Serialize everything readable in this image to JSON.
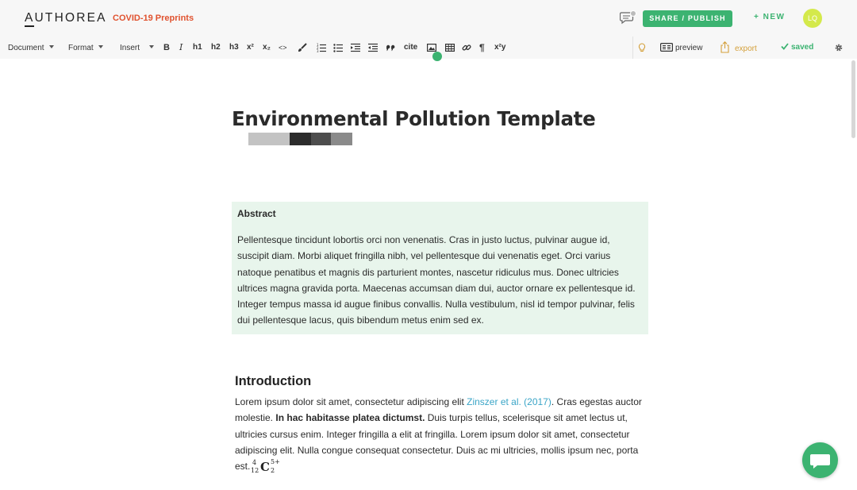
{
  "header": {
    "logo": "AUTHOREA",
    "covid_link": "COVID-19 Preprints",
    "share_label": "SHARE / PUBLISH",
    "new_label": "+ NEW",
    "avatar_initials": "LQ"
  },
  "toolbar": {
    "menus": [
      "Document",
      "Format",
      "Insert"
    ],
    "buttons": {
      "bold": "B",
      "italic": "I",
      "h1": "h1",
      "h2": "h2",
      "h3": "h3",
      "superscript": "x²",
      "subscript": "x₂",
      "code": "<>",
      "cite": "cite",
      "paragraph": "¶",
      "math": "x²y"
    },
    "preview_label": "preview",
    "export_label": "export",
    "saved_label": "saved"
  },
  "document": {
    "title": "Environmental Pollution Template",
    "abstract": {
      "heading": "Abstract",
      "body": "Pellentesque tincidunt lobortis orci non venenatis. Cras in justo luctus, pulvinar augue id, suscipit diam. Morbi aliquet fringilla nibh, vel pellentesque dui venenatis eget. Orci varius natoque penatibus et magnis dis parturient montes, nascetur ridiculus mus. Donec ultricies ultrices magna gravida porta. Maecenas accumsan diam dui, auctor ornare ex pellentesque id. Integer tempus massa id augue finibus convallis. Nulla vestibulum, nisl id tempor pulvinar, felis dui pellentesque lacus, quis bibendum metus enim sed ex."
    },
    "introduction": {
      "heading": "Introduction",
      "text_1": "Lorem ipsum dolor sit amet, consectetur adipiscing elit ",
      "citation": "Zinszer et al. (2017)",
      "text_2": ". Cras egestas auctor molestie. ",
      "bold_text": "In hac habitasse platea dictumst.",
      "text_3": " Duis turpis tellus, scelerisque sit amet lectus ut, ultricies cursus enim. Integer fringilla a elit at fringilla. Lorem ipsum dolor sit amet, consectetur adipiscing elit. Nulla congue consequat consectetur. Duis ac mi ultricies, mollis ipsum nec, porta est.",
      "math": {
        "pre_sup": "4",
        "pre_sub": "12",
        "base": "C",
        "sup": "5+",
        "sub": "2"
      }
    }
  },
  "icons": {
    "comments": "speech-bubble-icon",
    "chat": "chat-bubble-icon",
    "idea": "lightbulb-icon",
    "settings": "gear-icon"
  },
  "colors": {
    "accent_green": "#3cb371",
    "covid_red": "#e0522f",
    "link_blue": "#3aa5c7",
    "abstract_bg": "#e8f5ec",
    "export_gold": "#d4a03b",
    "avatar_yellow": "#d4e94b"
  }
}
